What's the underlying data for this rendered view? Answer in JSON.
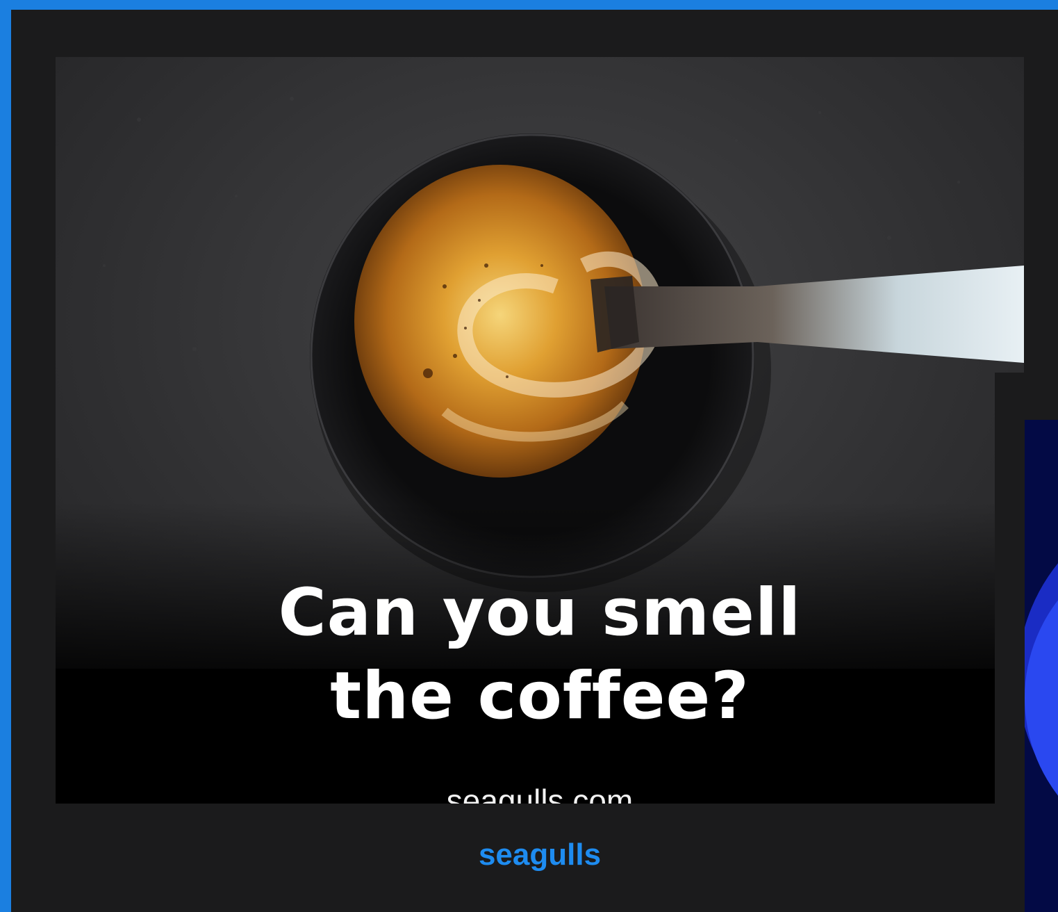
{
  "hero": {
    "headline_line1": "Can you smell",
    "headline_line2": "the coffee?",
    "site_url": "seagulls.com"
  },
  "footer": {
    "brand_label": "seagulls"
  },
  "colors": {
    "frame_blue": "#1b7fe0",
    "card_bg": "#1b1b1c",
    "brand_blue": "#1e8cf0",
    "side_panel_navy": "#030a45"
  },
  "icons": [
    "coffee-cup-image"
  ]
}
